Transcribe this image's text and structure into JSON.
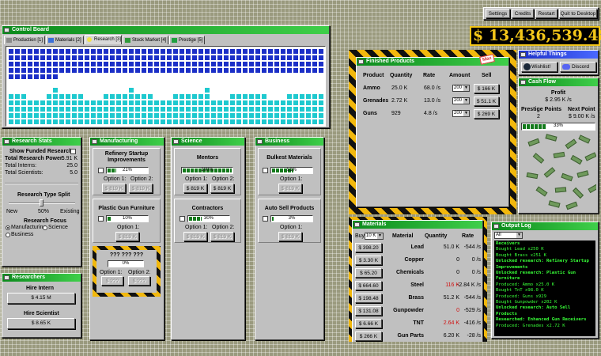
{
  "top_buttons": [
    "Settings",
    "Credits",
    "Restart",
    "Quit to Desktop"
  ],
  "money": "$ 13,436,539.48",
  "control_board": {
    "title": "Control Board",
    "tabs": [
      {
        "label": "Production [1]",
        "icon": "factory-icon"
      },
      {
        "label": "Materials [2]",
        "icon": "materials-icon"
      },
      {
        "label": "Research [3]",
        "icon": "bulb-icon"
      },
      {
        "label": "Stock Market [4]",
        "icon": "chart-icon"
      },
      {
        "label": "Prestige [5]",
        "icon": "prestige-icon"
      }
    ],
    "active_tab": 2
  },
  "research_stats": {
    "title": "Research Stats",
    "show_funded_label": "Show Funded Research",
    "total_power_label": "Total Research Power:",
    "total_power": "5.91 K",
    "interns_label": "Total Interns:",
    "interns": "25.0",
    "scientists_label": "Total Scientists:",
    "scientists": "5.0",
    "split_label": "Research Type Split",
    "split_new": "New",
    "split_value": "50%",
    "split_existing": "Existing",
    "split_fraction": 0.5,
    "focus_label": "Research Focus",
    "focus_options": [
      "Manufacturing",
      "Science",
      "Business"
    ],
    "focus_selected": 0
  },
  "researchers": {
    "title": "Researchers",
    "hire_intern_label": "Hire Intern",
    "hire_intern_cost": "$ 4.15 M",
    "hire_scientist_label": "Hire Scientist",
    "hire_scientist_cost": "$ 8.65 K"
  },
  "manufacturing": {
    "title": "Manufacturing",
    "items": [
      {
        "name": "Refinery Startup Improvements",
        "pct": "21%",
        "progress": 0.21,
        "option1": "Option 1:",
        "option2": "Option 2:",
        "cost1": "$ 819 K",
        "cost2": "$ 819 K"
      },
      {
        "name": "Plastic Gun Furniture",
        "pct": "10%",
        "progress": 0.1,
        "option1": "Option 1:",
        "cost1": "$ 819 K"
      },
      {
        "name": "??? ??? ???",
        "pct": "0%",
        "progress": 0.0,
        "option1": "Option 1:",
        "option2": "Option 2:",
        "cost1": "$ ???",
        "cost2": "$ ???"
      }
    ]
  },
  "science": {
    "title": "Science",
    "items": [
      {
        "name": "Mentors",
        "pct": "100%",
        "progress": 1.0,
        "option1": "Option 1:",
        "option2": "Option 2:",
        "cost1": "$ 819 K",
        "cost2": "$ 819 K"
      },
      {
        "name": "Contractors",
        "pct": "30%",
        "progress": 0.3,
        "option1": "Option 1:",
        "option2": "Option 2:",
        "cost1": "$ 819 K",
        "cost2": "$ 819 K"
      }
    ]
  },
  "business": {
    "title": "Business",
    "items": [
      {
        "name": "Bulkest Materials",
        "pct": "51%",
        "progress": 0.51,
        "option1": "Option 1:",
        "cost1": "$ 819 K"
      },
      {
        "name": "Auto Sell Products",
        "pct": "3%",
        "progress": 0.03,
        "option1": "Option 1:",
        "cost1": "$ 819 K"
      }
    ]
  },
  "finished_products": {
    "title": "Finished Products",
    "badge": "Max",
    "headers": [
      "Product",
      "Quantity",
      "Rate",
      "Amount",
      "Sell"
    ],
    "rows": [
      {
        "product": "Ammo",
        "quantity": "25.0 K",
        "rate": "68.0 /s",
        "amount": "200",
        "sell": "$ 166 K"
      },
      {
        "product": "Grenades",
        "quantity": "2.72 K",
        "rate": "13.0 /s",
        "amount": "200",
        "sell": "$ 51.1 K"
      },
      {
        "product": "Guns",
        "quantity": "929",
        "rate": "4.8 /s",
        "amount": "200",
        "sell": "$ 269 K"
      }
    ]
  },
  "helpful_things": {
    "title": "Helpful Things",
    "wishlist": "Wishlist!",
    "discord": "Discord"
  },
  "cash_flow": {
    "title": "Cash Flow",
    "profit_label": "Profit",
    "profit_value": "$ 2.95 K /s",
    "prestige_label": "Prestige Points",
    "prestige_value": "2",
    "next_point_label": "Next Point",
    "next_point_value": "$ 9.00 K /s",
    "progress_pct": "33%",
    "progress": 0.33
  },
  "materials": {
    "title": "Materials",
    "buy_label": "Buy",
    "buy_amount": "10 K",
    "headers": [
      "Material",
      "Quantity",
      "Rate"
    ],
    "rows": [
      {
        "cost": "$ 398.20",
        "material": "Lead",
        "quantity": "51.0 K",
        "rate": "-544 /s",
        "low": false
      },
      {
        "cost": "$ 3.30 K",
        "material": "Copper",
        "quantity": "0",
        "rate": "0 /s",
        "low": false
      },
      {
        "cost": "$ 65.20",
        "material": "Chemicals",
        "quantity": "0",
        "rate": "0 /s",
        "low": false
      },
      {
        "cost": "$ 664.60",
        "material": "Steel",
        "quantity": "116 K",
        "rate": "-2.84 K /s",
        "low": true
      },
      {
        "cost": "$ 198.48",
        "material": "Brass",
        "quantity": "51.2 K",
        "rate": "-544 /s",
        "low": false
      },
      {
        "cost": "$ 131.08",
        "material": "Gunpowder",
        "quantity": "0",
        "rate": "-529 /s",
        "low": true
      },
      {
        "cost": "$ 6.66 K",
        "material": "TNT",
        "quantity": "2.64 K",
        "rate": "-416 /s",
        "low": true
      },
      {
        "cost": "$ 266 K",
        "material": "Gun Parts",
        "quantity": "6.20 K",
        "rate": "-28 /s",
        "low": false
      }
    ]
  },
  "output_log": {
    "title": "Output Log",
    "filter": "All",
    "lines": [
      {
        "text": "Receivers",
        "bold": true
      },
      {
        "text": "Bought Lead x250 K",
        "bold": false
      },
      {
        "text": "Bought Brass x251 K",
        "bold": false
      },
      {
        "text": "Unlocked research:  Refinery Startup Improvements",
        "bold": true
      },
      {
        "text": "Unlocked research:  Plastic Gun Furniture",
        "bold": true
      },
      {
        "text": "Produced: Ammo x25.0 K",
        "bold": false
      },
      {
        "text": "Bought TnT x98.0 K",
        "bold": false
      },
      {
        "text": "Produced: Guns x929",
        "bold": false
      },
      {
        "text": "Bought Gunpowder x202 K",
        "bold": false
      },
      {
        "text": "Unlocked research:  Auto Sell Products",
        "bold": true
      },
      {
        "text": "Researched:  Enhanced Gun Receivers",
        "bold": true
      },
      {
        "text": "Produced: Grenades x2.72 K",
        "bold": false
      }
    ]
  },
  "colors": {
    "title_green": "#0b8a1c",
    "accent_blue": "#1b2fc7",
    "cyan_cells": "#1ec9cf",
    "money_gold": "#f2c61a",
    "hazard_yellow": "#f2b80d",
    "log_green": "#38ff38"
  }
}
